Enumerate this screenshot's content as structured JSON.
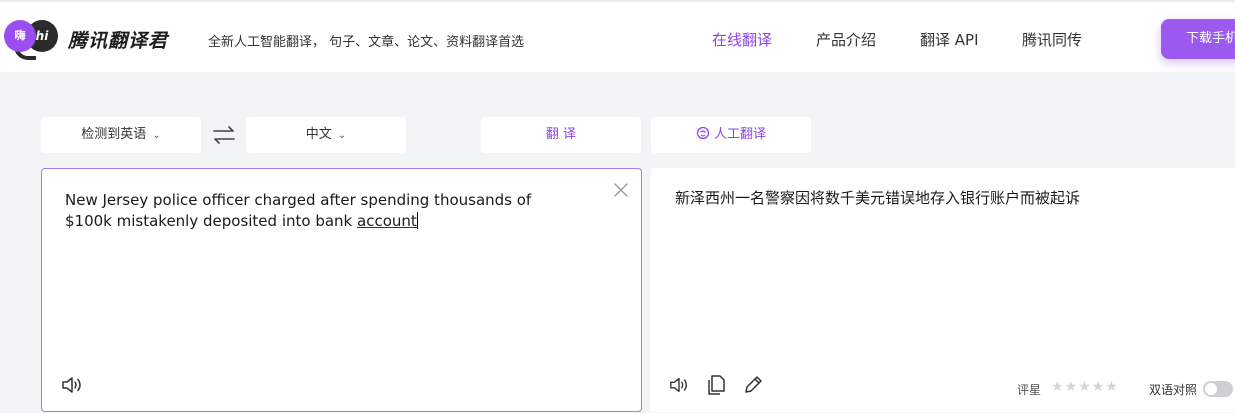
{
  "header": {
    "logo_left": "嗨",
    "logo_right": "hi",
    "brand": "腾讯翻译君",
    "slogan": "全新人工智能翻译， 句子、文章、论文、资料翻译首选",
    "nav": [
      {
        "label": "在线翻译",
        "active": true
      },
      {
        "label": "产品介绍",
        "active": false
      },
      {
        "label": "翻译 API",
        "active": false
      },
      {
        "label": "腾讯同传",
        "active": false
      }
    ],
    "download_label": "下载手机"
  },
  "toolbar": {
    "source_lang": "检测到英语",
    "target_lang": "中文",
    "translate_label": "翻 译",
    "human_translate_label": "人工翻译"
  },
  "source": {
    "line1": "New Jersey police officer charged after spending thousands of",
    "line2_prefix": "$100k mistakenly deposited into bank ",
    "line2_underlined": "account"
  },
  "target": {
    "text": "新泽西州一名警察因将数千美元错误地存入银行账户而被起诉",
    "rating_label": "评星",
    "stars": "★★★★★",
    "bilingual_label": "双语对照"
  },
  "colors": {
    "accent": "#8b46e6",
    "download_bg": "#9b59f0",
    "page_bg": "#f3f4f6"
  }
}
